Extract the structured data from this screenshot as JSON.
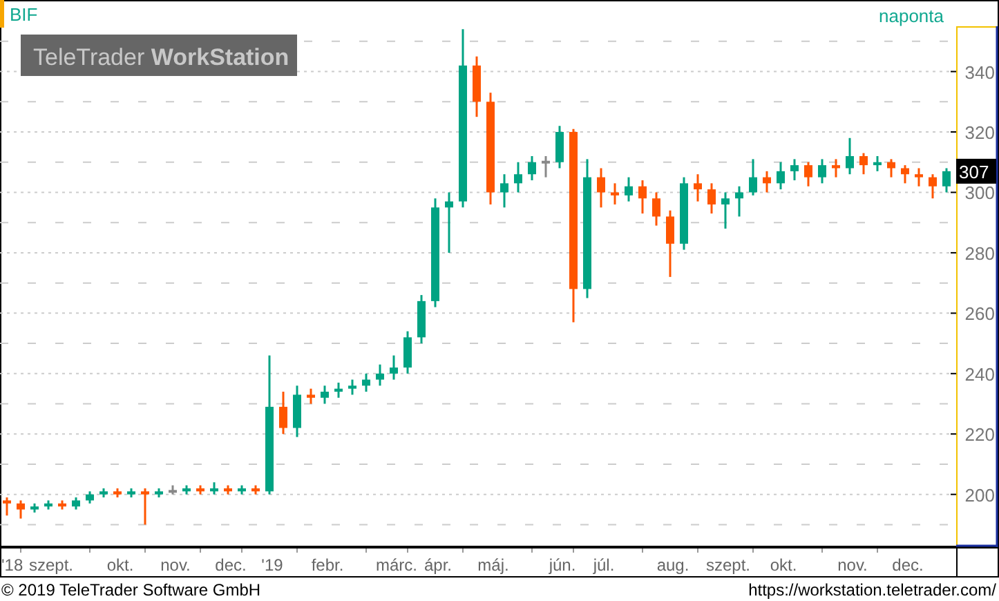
{
  "chart": {
    "interval": "naponta",
    "logo": {
      "brand": "TeleTrader",
      "product": "WorkStation"
    },
    "last_label": "307",
    "chart_data": {
      "type": "candlestick",
      "grid": true,
      "ylim": [
        183,
        355
      ],
      "yticks": [
        200,
        220,
        240,
        260,
        280,
        300,
        320,
        340
      ],
      "categories": [
        "'18",
        null,
        null,
        "szept.",
        null,
        null,
        null,
        null,
        "okt.",
        null,
        null,
        null,
        "nov.",
        null,
        null,
        null,
        "dec.",
        null,
        null,
        "'19",
        null,
        null,
        null,
        "febr.",
        null,
        null,
        null,
        null,
        "márc.",
        null,
        null,
        "ápr.",
        null,
        null,
        null,
        "máj.",
        null,
        null,
        null,
        null,
        "jún.",
        null,
        null,
        "júl.",
        null,
        null,
        null,
        null,
        "aug.",
        null,
        null,
        null,
        "szept.",
        null,
        null,
        null,
        "okt.",
        null,
        null,
        null,
        null,
        "nov.",
        null,
        null,
        null,
        "dec.",
        null,
        null,
        null
      ],
      "series": [
        {
          "name": "BIF",
          "ohlc": [
            [
              198,
              199,
              193,
              197
            ],
            [
              197,
              198,
              192,
              195
            ],
            [
              195,
              197,
              194,
              196
            ],
            [
              196,
              198,
              195,
              197
            ],
            [
              197,
              198,
              195,
              196
            ],
            [
              196,
              199,
              195,
              198
            ],
            [
              198,
              201,
              197,
              200
            ],
            [
              200,
              202,
              199,
              201
            ],
            [
              201,
              202,
              199,
              200
            ],
            [
              200,
              202,
              199,
              201
            ],
            [
              201,
              202,
              190,
              200
            ],
            [
              200,
              202,
              199,
              201
            ],
            [
              201,
              203,
              200,
              201
            ],
            [
              201,
              203,
              200,
              202
            ],
            [
              202,
              203,
              200,
              201
            ],
            [
              201,
              204,
              200,
              202
            ],
            [
              202,
              203,
              200,
              201
            ],
            [
              201,
              203,
              200,
              202
            ],
            [
              202,
              203,
              200,
              201
            ],
            [
              201,
              246,
              200,
              229
            ],
            [
              229,
              234,
              220,
              222
            ],
            [
              222,
              236,
              219,
              233
            ],
            [
              233,
              235,
              230,
              232
            ],
            [
              232,
              236,
              230,
              234
            ],
            [
              234,
              237,
              232,
              235
            ],
            [
              235,
              238,
              233,
              236
            ],
            [
              236,
              240,
              234,
              238
            ],
            [
              238,
              243,
              236,
              240
            ],
            [
              240,
              246,
              238,
              242
            ],
            [
              242,
              254,
              240,
              252
            ],
            [
              252,
              266,
              250,
              264
            ],
            [
              264,
              298,
              262,
              295
            ],
            [
              295,
              300,
              280,
              297
            ],
            [
              297,
              354,
              295,
              342
            ],
            [
              342,
              345,
              325,
              330
            ],
            [
              330,
              333,
              296,
              300
            ],
            [
              300,
              306,
              295,
              303
            ],
            [
              303,
              310,
              300,
              306
            ],
            [
              306,
              312,
              304,
              310
            ],
            [
              310,
              312,
              305,
              310
            ],
            [
              310,
              322,
              308,
              320
            ],
            [
              320,
              321,
              257,
              268
            ],
            [
              268,
              311,
              265,
              305
            ],
            [
              305,
              308,
              295,
              300
            ],
            [
              300,
              303,
              296,
              299
            ],
            [
              299,
              305,
              297,
              302
            ],
            [
              302,
              304,
              293,
              298
            ],
            [
              298,
              300,
              289,
              292
            ],
            [
              292,
              294,
              272,
              283
            ],
            [
              283,
              305,
              281,
              303
            ],
            [
              303,
              306,
              297,
              301
            ],
            [
              301,
              303,
              293,
              296
            ],
            [
              296,
              300,
              288,
              298
            ],
            [
              298,
              302,
              292,
              300
            ],
            [
              300,
              311,
              299,
              305
            ],
            [
              305,
              307,
              300,
              303
            ],
            [
              303,
              310,
              301,
              307
            ],
            [
              307,
              311,
              304,
              309
            ],
            [
              309,
              310,
              302,
              305
            ],
            [
              305,
              311,
              303,
              309
            ],
            [
              309,
              311,
              305,
              308
            ],
            [
              308,
              318,
              306,
              312
            ],
            [
              312,
              313,
              306,
              309
            ],
            [
              309,
              312,
              307,
              310
            ],
            [
              310,
              311,
              305,
              308
            ],
            [
              308,
              309,
              303,
              306
            ],
            [
              306,
              308,
              302,
              305
            ],
            [
              305,
              306,
              298,
              302
            ],
            [
              302,
              308,
              300,
              307
            ]
          ]
        }
      ]
    }
  },
  "footer": {
    "copyright": "© 2019 TeleTrader Software GmbH",
    "url": "https://workstation.teletrader.com/"
  }
}
